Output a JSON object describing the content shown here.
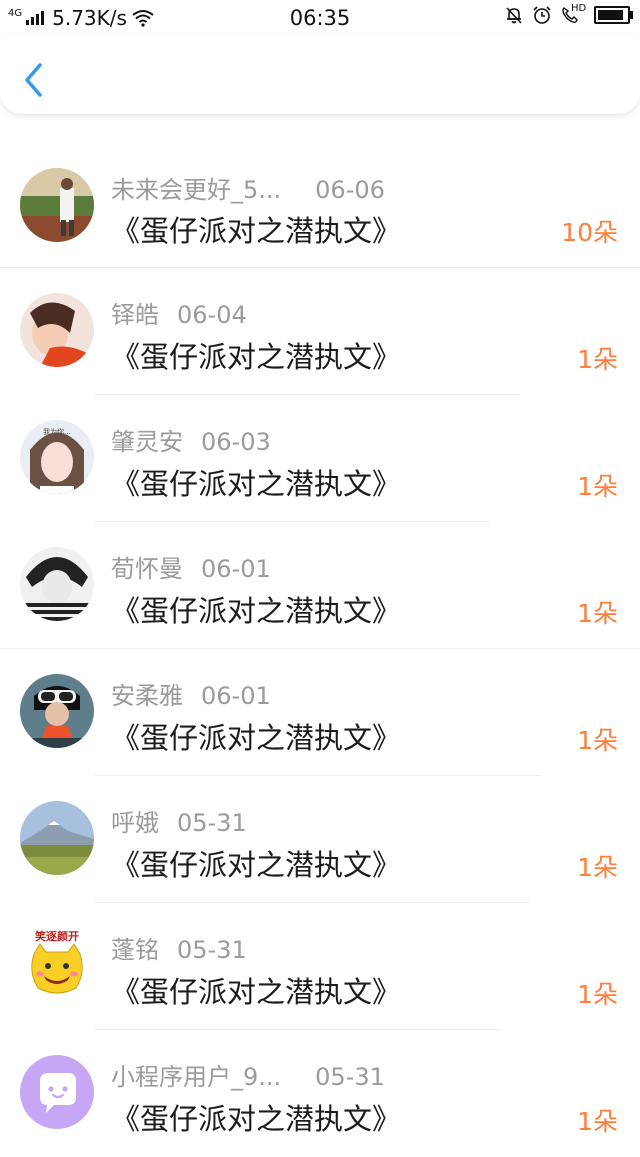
{
  "status_bar": {
    "network": "4G",
    "speed": "5.73K/s",
    "time": "06:35",
    "hd_label": "HD",
    "battery_level": 0.95
  },
  "header": {
    "back_icon": "chevron-left-icon"
  },
  "list": [
    {
      "name": "未来会更好_5...",
      "date": "06-06",
      "title": "《蛋仔派对之潜执文》",
      "amount": "10朵"
    },
    {
      "name": "铎皓",
      "date": "06-04",
      "title": "《蛋仔派对之潜执文》",
      "amount": "1朵"
    },
    {
      "name": "肇灵安",
      "date": "06-03",
      "title": "《蛋仔派对之潜执文》",
      "amount": "1朵"
    },
    {
      "name": "荀怀曼",
      "date": "06-01",
      "title": "《蛋仔派对之潜执文》",
      "amount": "1朵"
    },
    {
      "name": "安柔雅",
      "date": "06-01",
      "title": "《蛋仔派对之潜执文》",
      "amount": "1朵"
    },
    {
      "name": "呼娥",
      "date": "05-31",
      "title": "《蛋仔派对之潜执文》",
      "amount": "1朵"
    },
    {
      "name": "蓬铭",
      "date": "05-31",
      "title": "《蛋仔派对之潜执文》",
      "amount": "1朵"
    },
    {
      "name": "小程序用户_9...",
      "date": "05-31",
      "title": "《蛋仔派对之潜执文》",
      "amount": "1朵"
    }
  ],
  "avatar_texts": {
    "row3": "我为你...",
    "row7": "笑逐颜开"
  },
  "colors": {
    "accent": "#2f9bf0",
    "amount": "#ff7e3a",
    "meta_text": "#9b9b9b"
  }
}
